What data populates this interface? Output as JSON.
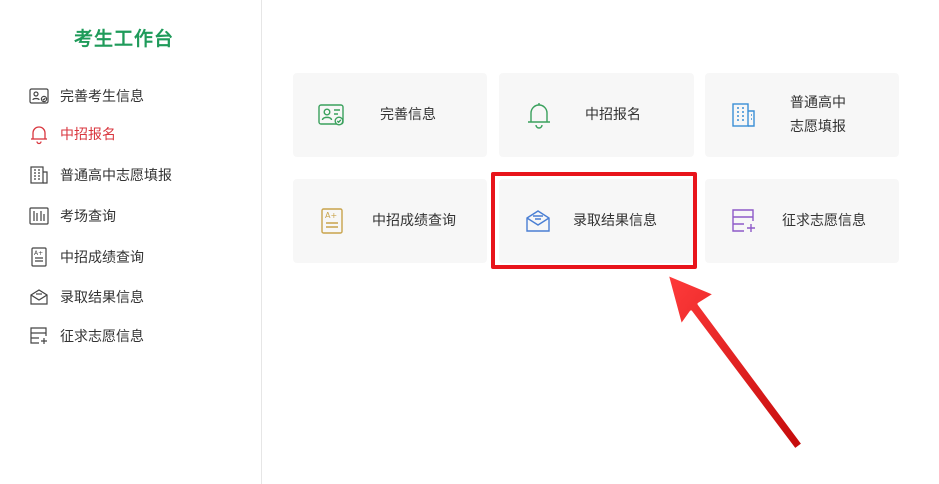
{
  "sidebar": {
    "title": "考生工作台",
    "items": [
      {
        "label": "完善考生信息",
        "icon": "id-card-icon"
      },
      {
        "label": "中招报名",
        "icon": "bell-icon",
        "active": true
      },
      {
        "label": "普通高中志愿填报",
        "icon": "building-icon"
      },
      {
        "label": "考场查询",
        "icon": "exam-room-icon"
      },
      {
        "label": "中招成绩查询",
        "icon": "score-doc-icon"
      },
      {
        "label": "录取结果信息",
        "icon": "envelope-icon"
      },
      {
        "label": "征求志愿信息",
        "icon": "form-plus-icon"
      }
    ]
  },
  "cards": [
    {
      "label": "完善信息",
      "icon": "id-card-icon",
      "color": "#3aa15d"
    },
    {
      "label": "中招报名",
      "icon": "bell-icon",
      "color": "#3aa15d"
    },
    {
      "label_line1": "普通高中",
      "label_line2": "志愿填报",
      "icon": "building-icon",
      "color": "#3b8fd6"
    },
    {
      "label": "中招成绩查询",
      "icon": "score-doc-icon",
      "color": "#c9a44c"
    },
    {
      "label": "录取结果信息",
      "icon": "envelope-icon",
      "color": "#4a7fd4",
      "highlighted": true
    },
    {
      "label": "征求志愿信息",
      "icon": "form-plus-icon",
      "color": "#8e5ac8"
    }
  ],
  "colors": {
    "accent": "#1f9b5a",
    "active": "#d9363e",
    "highlight": "#e8141b"
  }
}
